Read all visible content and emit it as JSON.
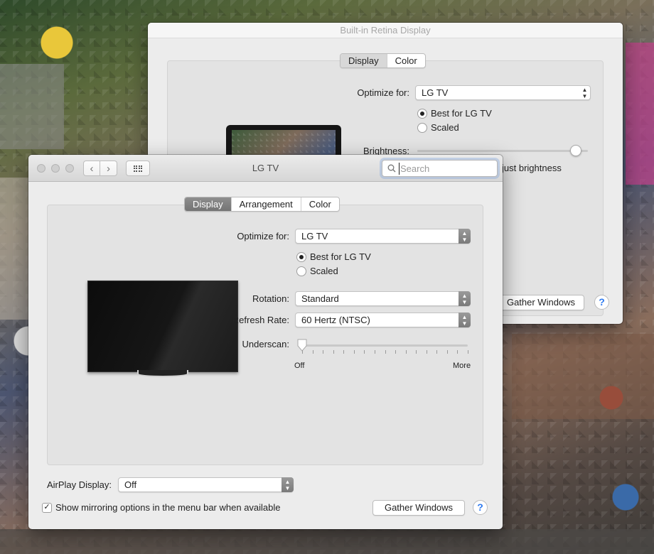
{
  "back_window": {
    "title": "Built-in Retina Display",
    "tabs": [
      "Display",
      "Color"
    ],
    "optimize_label": "Optimize for:",
    "optimize_value": "LG TV",
    "radio_best": "Best for LG TV",
    "radio_scaled": "Scaled",
    "brightness_label": "Brightness:",
    "auto_brightness_text": "just brightness",
    "brightness_level": 0.93,
    "gather_button": "Gather Windows",
    "help": "?"
  },
  "front_window": {
    "title": "LG TV",
    "search_placeholder": "Search",
    "tabs": [
      "Display",
      "Arrangement",
      "Color"
    ],
    "optimize_label": "Optimize for:",
    "optimize_value": "LG TV",
    "radio_best": "Best for LG TV",
    "radio_scaled": "Scaled",
    "rotation_label": "Rotation:",
    "rotation_value": "Standard",
    "refresh_label": "Refresh Rate:",
    "refresh_value": "60 Hertz (NTSC)",
    "underscan_label": "Underscan:",
    "underscan_min": "Off",
    "underscan_max": "More",
    "underscan_level": 0,
    "airplay_label": "AirPlay Display:",
    "airplay_value": "Off",
    "mirroring_label": "Show mirroring options in the menu bar when available",
    "mirroring_checked": true,
    "gather_button": "Gather Windows",
    "help": "?"
  },
  "icons": {
    "back": "chevron-left-icon",
    "forward": "chevron-right-icon",
    "grid": "show-all-grid-icon",
    "search": "magnifier-icon"
  }
}
